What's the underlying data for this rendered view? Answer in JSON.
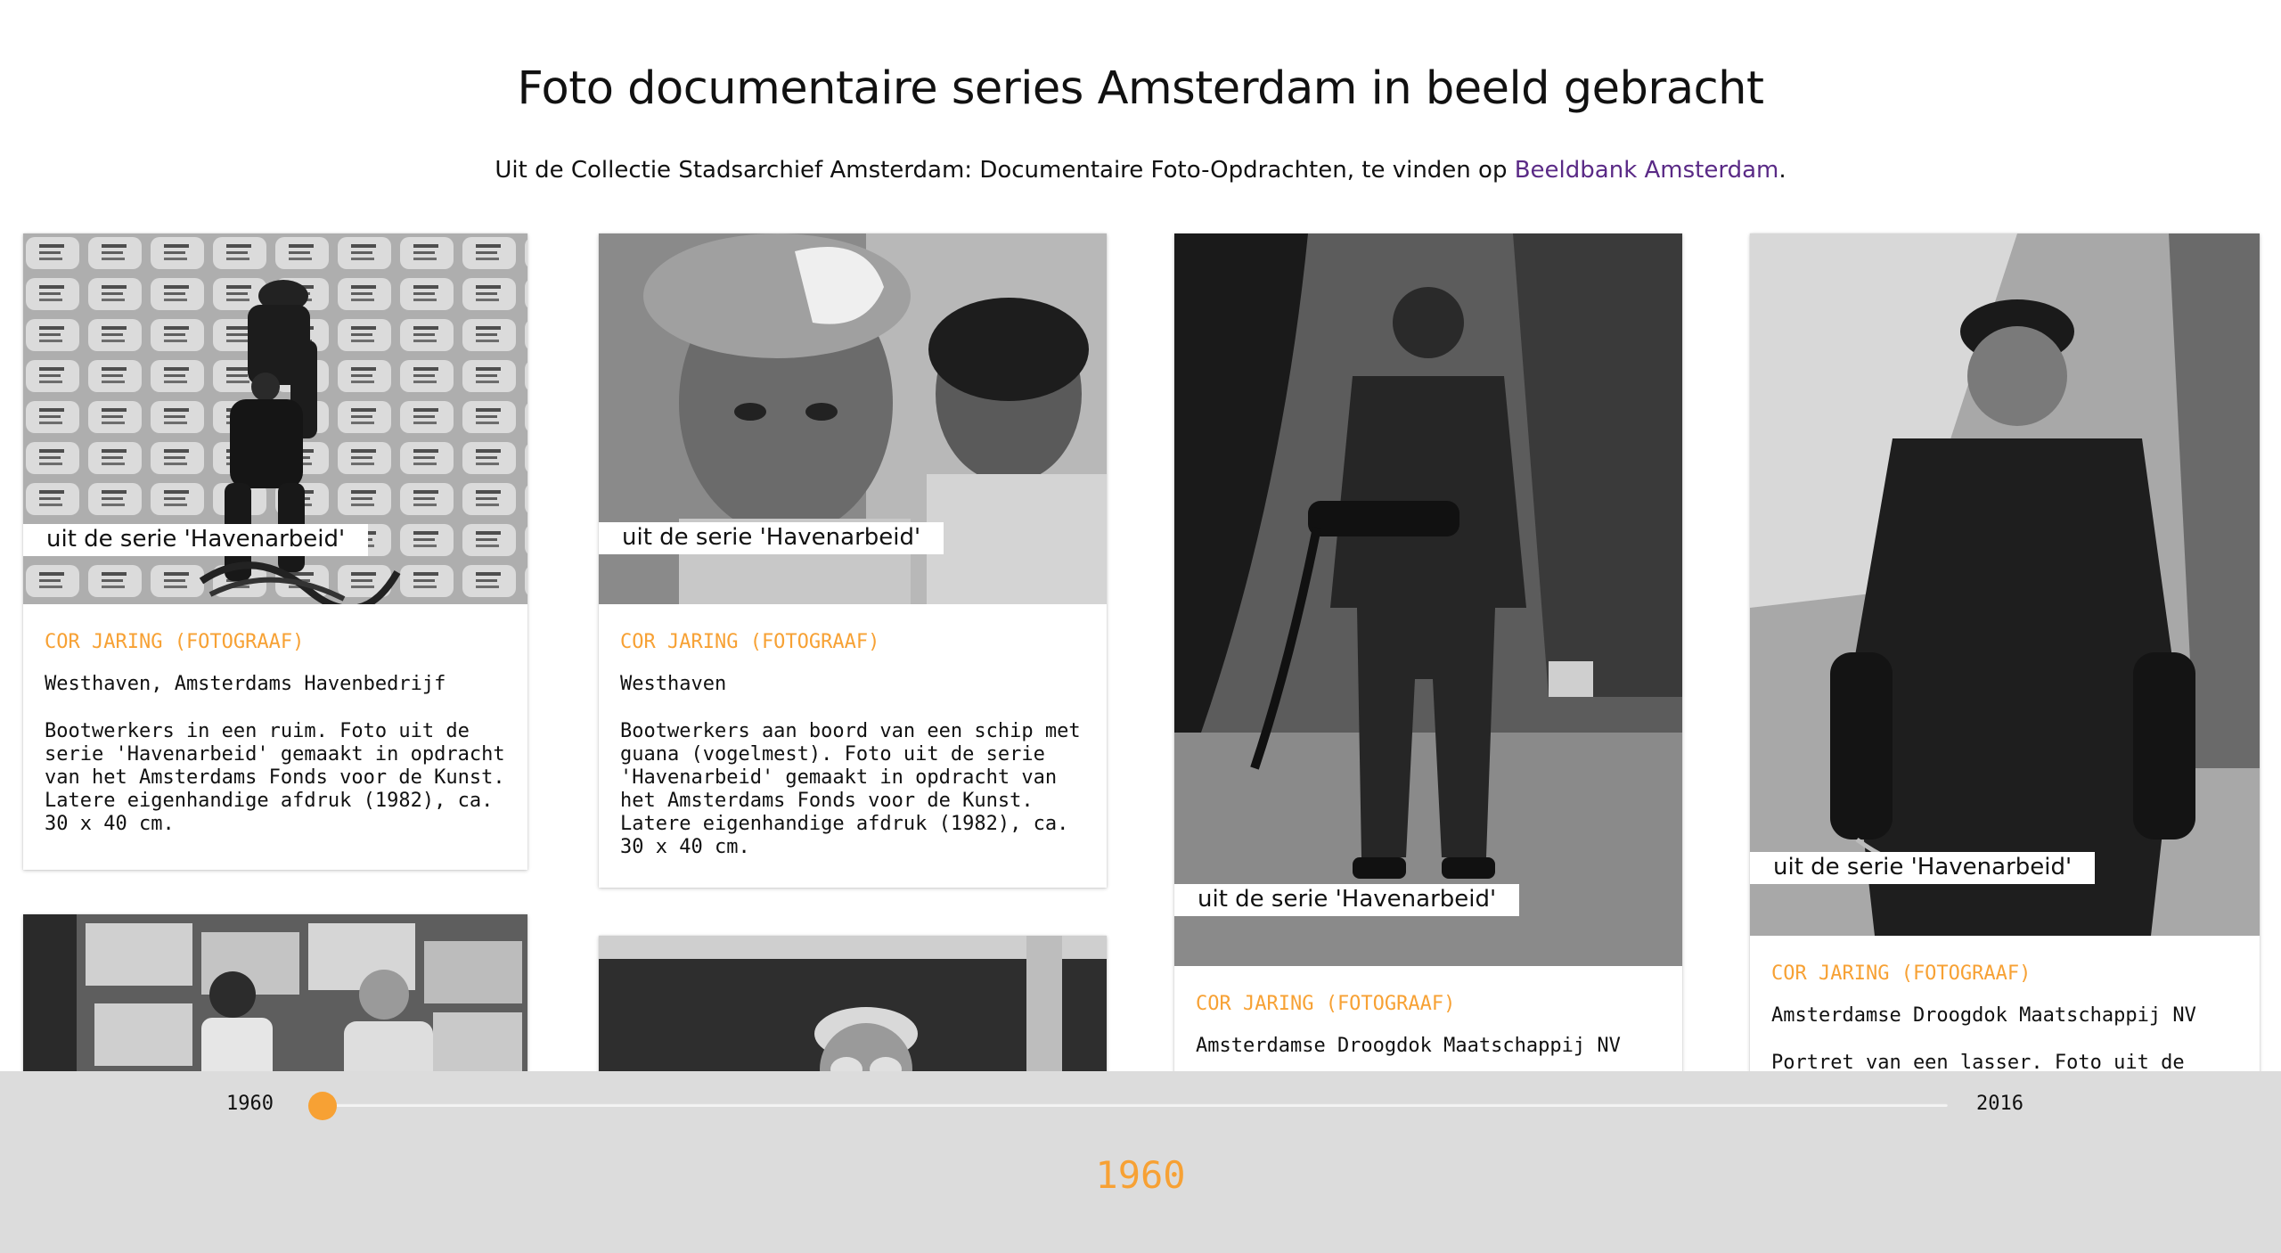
{
  "header": {
    "title": "Foto documentaire series Amsterdam in beeld gebracht",
    "subtitle_prefix": "Uit de Collectie Stadsarchief Amsterdam: Documentaire Foto-Opdrachten, te vinden op ",
    "subtitle_link": "Beeldbank Amsterdam",
    "subtitle_suffix": "."
  },
  "cards": [
    {
      "tag": "uit de serie 'Havenarbeid'",
      "photographer": "Cor Jaring (fotograaf)",
      "location": "Westhaven, Amsterdams Havenbedrijf",
      "description": "Bootwerkers in een ruim. Foto uit de serie 'Havenarbeid' gemaakt in opdracht van het Amsterdams Fonds voor de Kunst. Latere eigenhandige afdruk (1982), ca. 30 x 40 cm."
    },
    {
      "tag": "uit de serie 'Havenarbeid'",
      "photographer": "Cor Jaring (fotograaf)",
      "location": "Westhaven",
      "description": "Bootwerkers aan boord van een schip met guana (vogelmest). Foto uit de serie 'Havenarbeid' gemaakt in opdracht van het Amsterdams Fonds voor de Kunst. Latere eigenhandige afdruk (1982), ca. 30 x 40 cm."
    },
    {
      "tag": "uit de serie 'Havenarbeid'",
      "photographer": "Cor Jaring (fotograaf)",
      "location": "Amsterdamse Droogdok Maatschappij NV",
      "description": ""
    },
    {
      "tag": "uit de serie 'Havenarbeid'",
      "photographer": "Cor Jaring (fotograaf)",
      "location": "Amsterdamse Droogdok Maatschappij NV",
      "description": "Portret van een lasser. Foto uit de"
    }
  ],
  "timeline": {
    "start_label": "1960",
    "end_label": "2016",
    "current": "1960",
    "position": 0
  },
  "colors": {
    "accent": "#f7a134",
    "link": "#5a2a86",
    "timeline_bg": "#dcdcdc"
  }
}
